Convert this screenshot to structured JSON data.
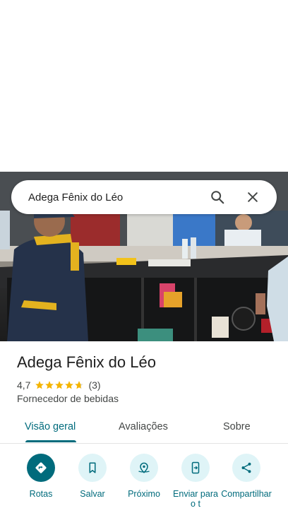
{
  "search": {
    "query": "Adega Fênix do Léo"
  },
  "place": {
    "title": "Adega Fênix do Léo",
    "rating": "4,7",
    "rating_value": 4.7,
    "review_count": "(3)",
    "category": "Fornecedor de bebidas"
  },
  "tabs": [
    {
      "label": "Visão geral",
      "active": true
    },
    {
      "label": "Avaliações",
      "active": false
    },
    {
      "label": "Sobre",
      "active": false
    }
  ],
  "actions": [
    {
      "label": "Rotas",
      "icon": "directions-icon"
    },
    {
      "label": "Salvar",
      "icon": "bookmark-icon"
    },
    {
      "label": "Próximo",
      "icon": "nearby-icon"
    },
    {
      "label": "Enviar para o t",
      "icon": "send-to-phone-icon"
    },
    {
      "label": "Compartilhar",
      "icon": "share-icon"
    }
  ],
  "colors": {
    "accent": "#006b7c",
    "accent_light": "#dff4f7",
    "star": "#f4b400"
  }
}
